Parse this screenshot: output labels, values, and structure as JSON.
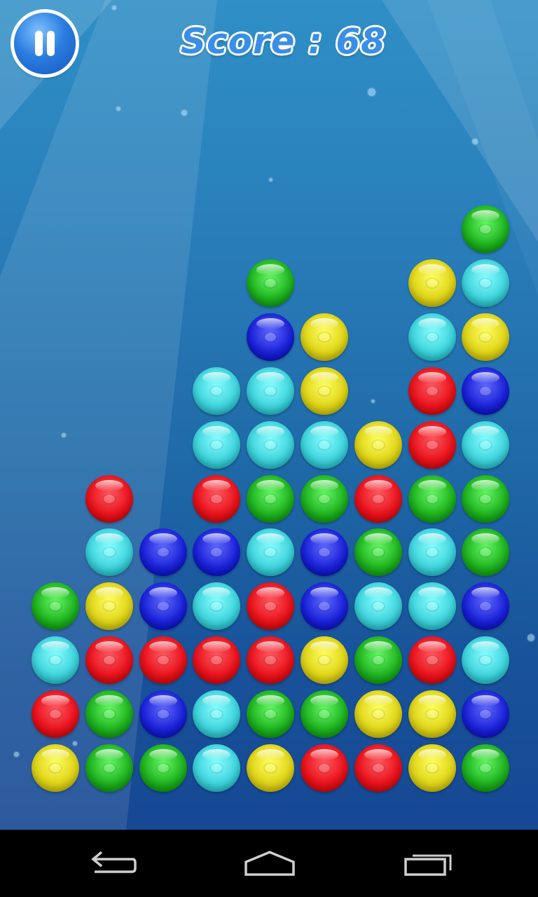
{
  "header": {
    "score_text": "Score : 68",
    "pause_icon": "pause-icon"
  },
  "colors": {
    "red": "#e8121b",
    "green": "#1fb21f",
    "blue": "#1a22d8",
    "cyan": "#3fd3dc",
    "yellow": "#dfd418"
  },
  "board": {
    "columns": 9,
    "rows": 11,
    "grid": [
      [
        null,
        null,
        null,
        null,
        null,
        null,
        null,
        null,
        "green"
      ],
      [
        null,
        null,
        null,
        null,
        "green",
        null,
        null,
        "yellow",
        "cyan"
      ],
      [
        null,
        null,
        null,
        null,
        "blue",
        "yellow",
        null,
        "cyan",
        "yellow"
      ],
      [
        null,
        null,
        null,
        "cyan",
        "cyan",
        "yellow",
        null,
        "red",
        "blue"
      ],
      [
        null,
        null,
        null,
        "cyan",
        "cyan",
        "cyan",
        "yellow",
        "red",
        "cyan"
      ],
      [
        null,
        "red",
        null,
        "red",
        "green",
        "green",
        "red",
        "green",
        "green"
      ],
      [
        null,
        "cyan",
        "blue",
        "blue",
        "cyan",
        "blue",
        "green",
        "cyan",
        "green"
      ],
      [
        "green",
        "yellow",
        "blue",
        "cyan",
        "red",
        "blue",
        "cyan",
        "cyan",
        "blue"
      ],
      [
        "cyan",
        "red",
        "red",
        "red",
        "red",
        "yellow",
        "green",
        "red",
        "cyan"
      ],
      [
        "red",
        "green",
        "blue",
        "cyan",
        "green",
        "green",
        "yellow",
        "yellow",
        "blue"
      ],
      [
        "yellow",
        "green",
        "green",
        "cyan",
        "yellow",
        "red",
        "red",
        "yellow",
        "green"
      ]
    ]
  },
  "navbar": {
    "back_icon": "back-icon",
    "home_icon": "home-icon",
    "recents_icon": "recents-icon"
  }
}
